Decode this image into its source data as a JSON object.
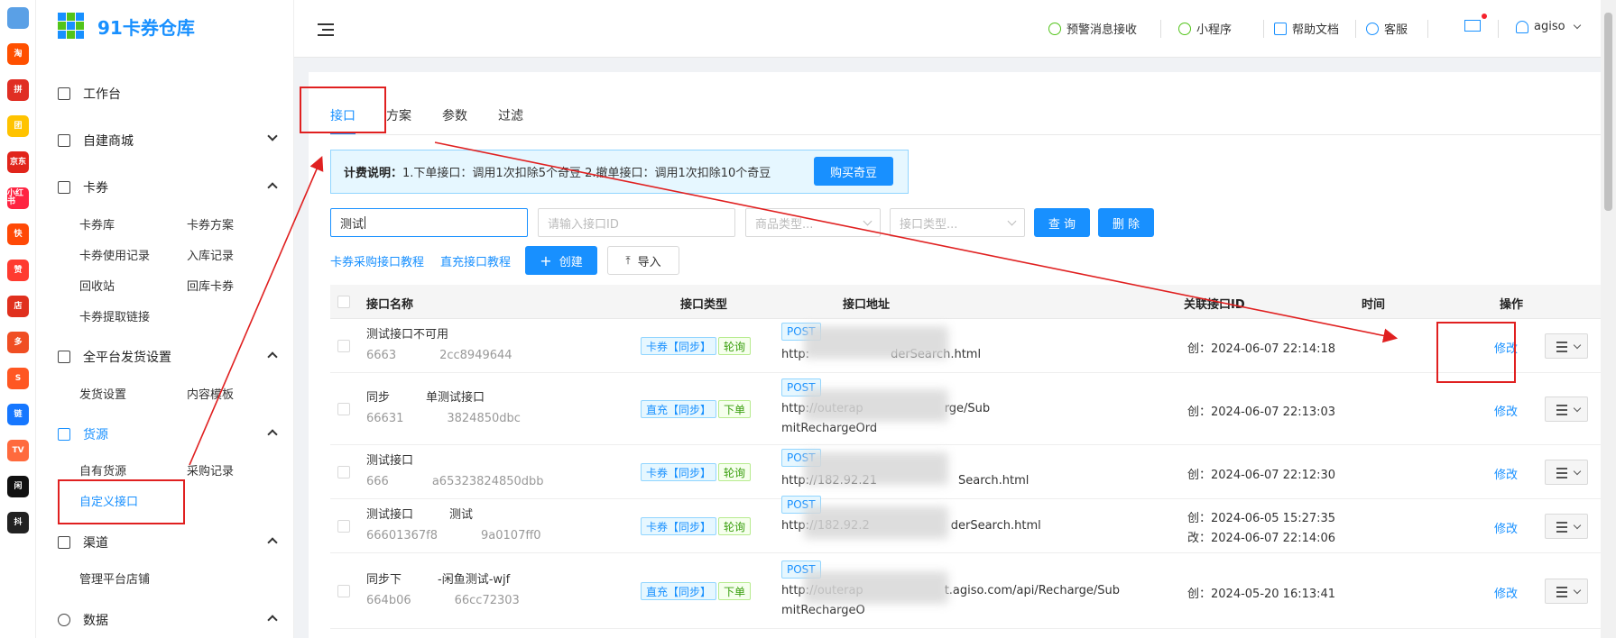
{
  "app": {
    "title": "91卡券仓库"
  },
  "rail": {
    "icons": [
      {
        "name": "app-logo-icon",
        "label": "",
        "color": "#5aa0e6"
      },
      {
        "name": "taobao-icon",
        "label": "淘",
        "color": "#ff5000"
      },
      {
        "name": "pinduoduo-icon",
        "label": "拼",
        "color": "#e02e24"
      },
      {
        "name": "meituan-icon",
        "label": "团",
        "color": "#ffc300"
      },
      {
        "name": "jd-icon",
        "label": "京东",
        "color": "#e1251b"
      },
      {
        "name": "xiaohongshu-icon",
        "label": "小红书",
        "color": "#ff2442"
      },
      {
        "name": "kuaishou-icon",
        "label": "快",
        "color": "#ff4906"
      },
      {
        "name": "like-icon",
        "label": "赞",
        "color": "#ff3b30"
      },
      {
        "name": "store-icon",
        "label": "店",
        "color": "#e0301e"
      },
      {
        "name": "pdd-shop-icon",
        "label": "多",
        "color": "#f04e23"
      },
      {
        "name": "shop-bag-icon",
        "label": "S",
        "color": "#ff5722"
      },
      {
        "name": "link-icon",
        "label": "链",
        "color": "#1677ff"
      },
      {
        "name": "tv-icon",
        "label": "TV",
        "color": "#ff6a3d"
      },
      {
        "name": "xianyu-icon",
        "label": "闲",
        "color": "#111111"
      },
      {
        "name": "tiktok-icon",
        "label": "抖",
        "color": "#222222"
      }
    ]
  },
  "sidebar": {
    "menus": [
      {
        "label": "工作台",
        "chevron": ""
      },
      {
        "label": "自建商城",
        "chevron": "down"
      },
      {
        "label": "卡券",
        "chevron": "up"
      },
      {
        "label": "全平台发货设置",
        "chevron": "up"
      },
      {
        "label": "货源",
        "chevron": "up"
      },
      {
        "label": "渠道",
        "chevron": "up"
      },
      {
        "label": "数据",
        "chevron": "up"
      }
    ],
    "sub": {
      "kaquan_ku": "卡券库",
      "kaquan_fangan": "卡券方案",
      "kaquan_shiyong": "卡券使用记录",
      "ruku": "入库记录",
      "huishouzhan": "回收站",
      "huiku": "回库卡券",
      "tiqu": "卡券提取链接",
      "fahuo_shezhi": "发货设置",
      "neirong_muban": "内容模板",
      "ziyou_huoyuan": "自有货源",
      "caigou_jilu": "采购记录",
      "zidingyi": "自定义接口",
      "guanli_dianpu": "管理平台店铺"
    }
  },
  "header": {
    "alert": "预警消息接收",
    "miniprogram": "小程序",
    "help": "帮助文档",
    "service": "客服",
    "user": "agiso"
  },
  "tabs": [
    "接口",
    "方案",
    "参数",
    "过滤"
  ],
  "notice": {
    "label": "计费说明：",
    "text": "1.下单接口：调用1次扣除5个奇豆 2.撤单接口：调用1次扣除10个奇豆",
    "buy": "购买奇豆"
  },
  "search": {
    "name_value": "测试",
    "id_placeholder": "请输入接口ID",
    "goods_type_placeholder": "商品类型...",
    "api_type_placeholder": "接口类型...",
    "query": "查 询",
    "delete": "删 除"
  },
  "links": {
    "tutorial1": "卡券采购接口教程",
    "tutorial2": "直充接口教程"
  },
  "actions": {
    "create": "创建",
    "import": "导入"
  },
  "table": {
    "headers": {
      "name": "接口名称",
      "type": "接口类型",
      "url": "接口地址",
      "related": "关联接口ID",
      "time": "时间",
      "op": "操作"
    },
    "rows": [
      {
        "name": "测试接口不可用",
        "id": "6663",
        "id_tail": "2cc8949644",
        "tag1": "卡券【同步】",
        "tag2": "轮询",
        "method": "POST",
        "url": "http:",
        "url_tail": "derSearch.html",
        "url2": "",
        "time1": "创：2024-06-07 22:14:18",
        "time2": "",
        "edit": "修改"
      },
      {
        "name": "同步",
        "name_tail": "单测试接口",
        "id": "66631",
        "id_tail": "3824850dbc",
        "tag1": "直充【同步】",
        "tag2": "下单",
        "method": "POST",
        "url": "http://outerap",
        "url_tail": "rge/Sub",
        "url2": "mitRechargeOrd",
        "time1": "创：2024-06-07 22:13:03",
        "time2": "",
        "edit": "修改"
      },
      {
        "name": "测试接口",
        "id": "666",
        "id_tail": "a65323824850dbb",
        "tag1": "卡券【同步】",
        "tag2": "轮询",
        "method": "POST",
        "url": "http://182.92.21",
        "url_tail": "Search.html",
        "url2": "",
        "time1": "创：2024-06-07 22:12:30",
        "time2": "",
        "edit": "修改"
      },
      {
        "name": "测试接口",
        "name_tail": "测试",
        "id": "66601367f8",
        "id_tail": "9a0107ff0",
        "tag1": "卡券【同步】",
        "tag2": "轮询",
        "method": "POST",
        "url": "http://182.92.2",
        "url_tail": "derSearch.html",
        "url2": "",
        "time1": "创：2024-06-05 15:27:35",
        "time2": "改：2024-06-07 22:14:06",
        "edit": "修改"
      },
      {
        "name": "同步下",
        "name_tail": "-闲鱼测试-wjf",
        "id": "664b06",
        "id_tail": "66cc72303",
        "tag1": "直充【同步】",
        "tag2": "下单",
        "method": "POST",
        "url": "http://outerap",
        "url_tail": "t.agiso.com/api/Recharge/Sub",
        "url2": "mitRechargeO",
        "time1": "创：2024-05-20 16:13:41",
        "time2": "",
        "edit": "修改"
      }
    ]
  },
  "colors": {
    "primary": "#1890ff",
    "annotation": "#e02020"
  }
}
